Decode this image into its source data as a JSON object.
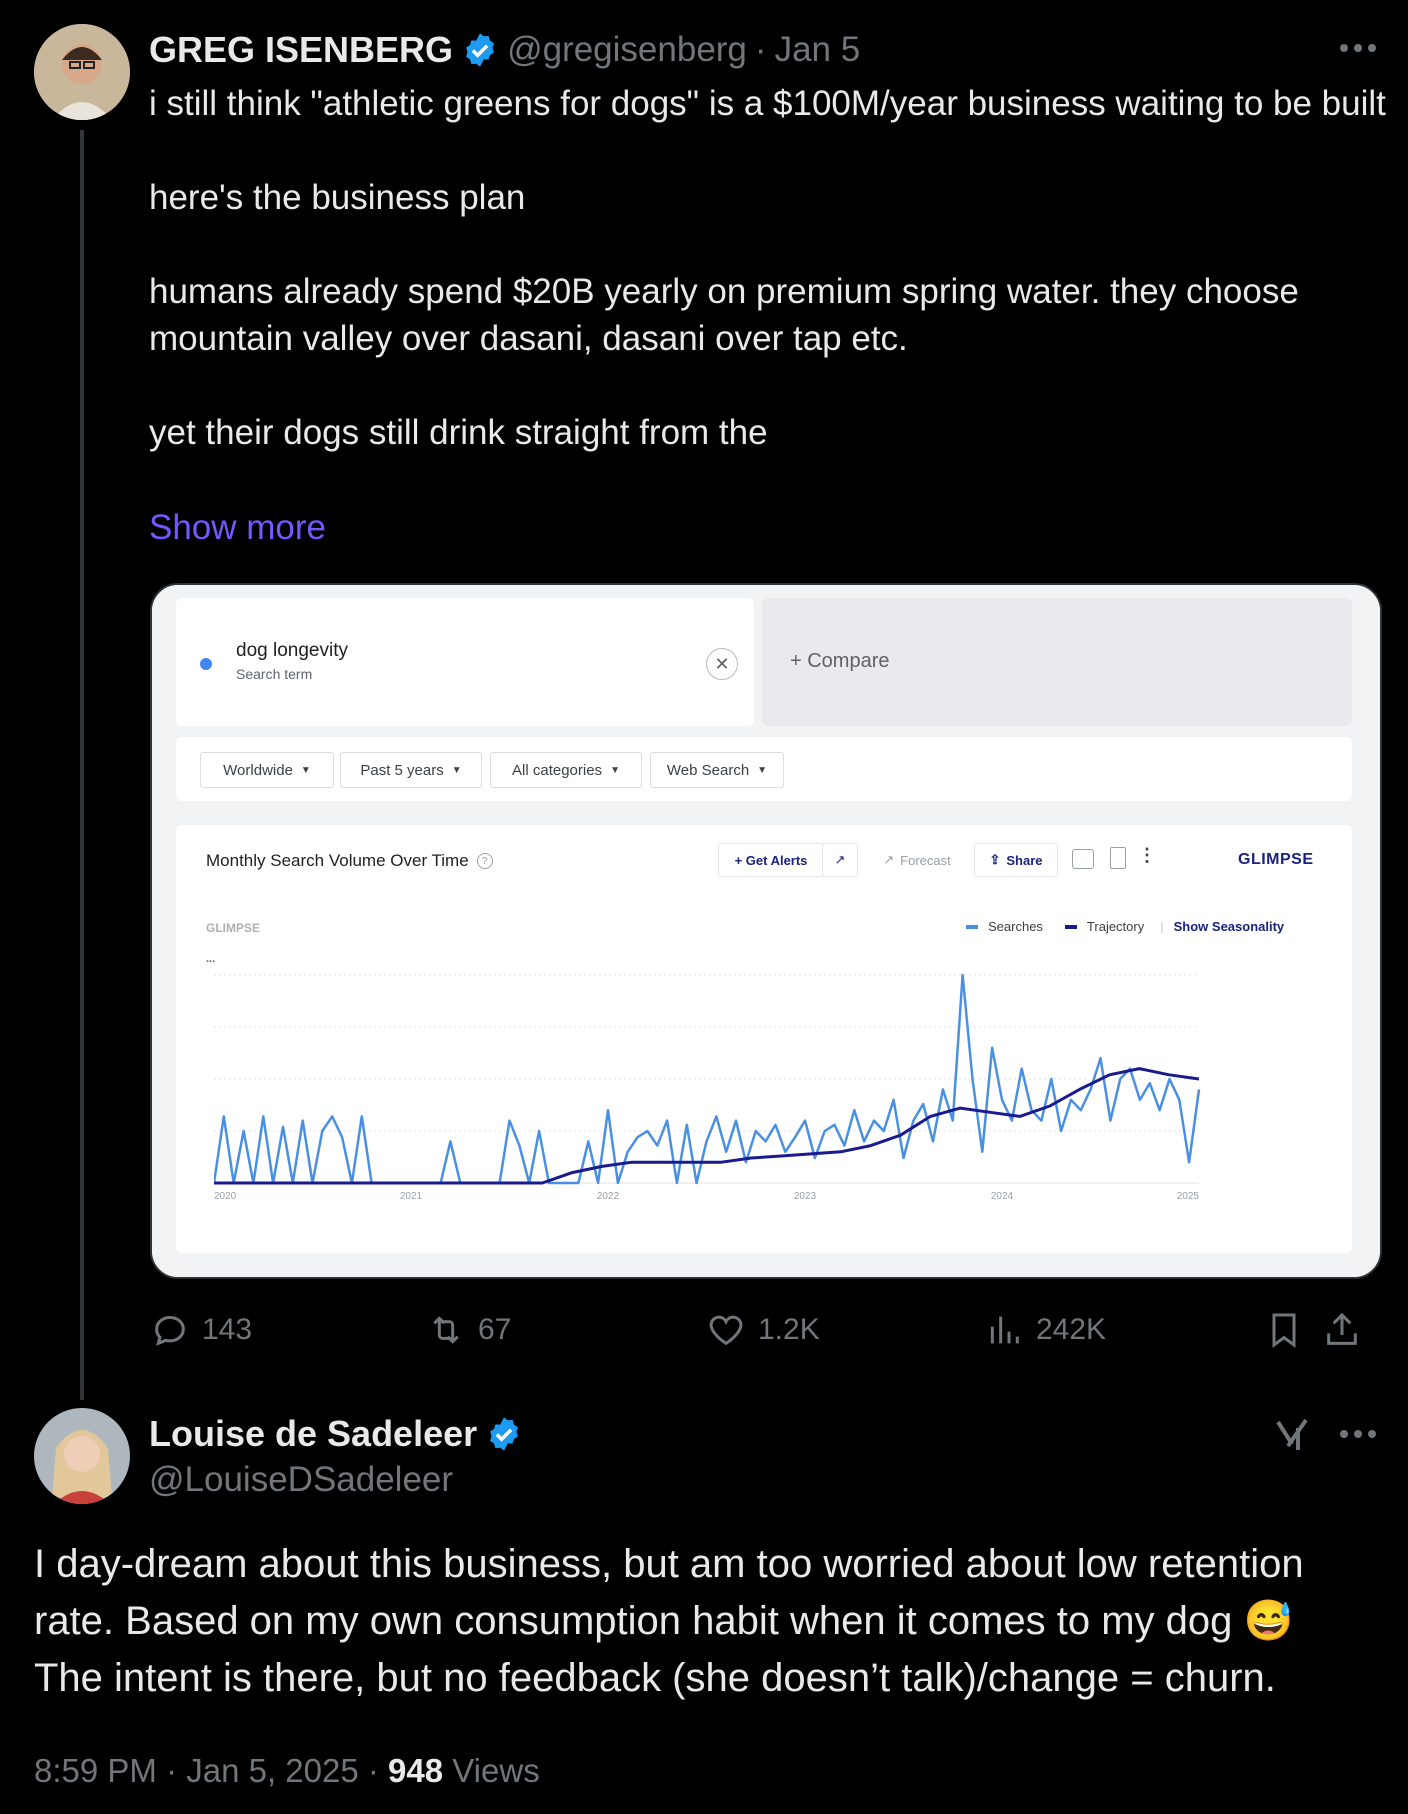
{
  "tweet": {
    "author_name": "GREG ISENBERG",
    "handle": "@gregisenberg",
    "date": "Jan 5",
    "text": "i still think \"athletic greens for dogs\" is a $100M/year business waiting to be built\n\nhere's the business plan\n\nhumans already spend $20B yearly on premium spring water. they choose mountain valley over dasani, dasani over tap etc.\n\nyet their dogs still drink straight from the",
    "show_more": "Show more",
    "more_icon": "ellipsis-icon",
    "metrics": {
      "replies": "143",
      "reposts": "67",
      "likes": "1.2K",
      "views": "242K"
    }
  },
  "embedded": {
    "search_term": "dog longevity",
    "search_term_sub": "Search term",
    "compare": "+ Compare",
    "filters": [
      "Worldwide",
      "Past 5 years",
      "All categories",
      "Web Search"
    ],
    "panel_title": "Monthly Search Volume Over Time",
    "toolbar": {
      "get_alerts": "+ Get Alerts",
      "forecast": "Forecast",
      "share": "Share",
      "brand": "GLIMPSE"
    },
    "watermark": "GLIMPSE",
    "legend": {
      "searches": "Searches",
      "trajectory": "Trajectory",
      "seasonality": "Show Seasonality"
    },
    "y_tick": "...",
    "colors": {
      "searches": "#4a90e2",
      "trajectory": "#1a1a8f"
    }
  },
  "chart_data": {
    "type": "line",
    "x": [
      "2020",
      "2021",
      "2022",
      "2023",
      "2024",
      "2025"
    ],
    "series": [
      {
        "name": "Searches",
        "values": [
          0,
          32,
          0,
          25,
          0,
          32,
          0,
          27,
          0,
          30,
          0,
          25,
          32,
          22,
          0,
          32,
          0,
          0,
          0,
          0,
          0,
          0,
          0,
          0,
          20,
          0,
          0,
          0,
          0,
          0,
          30,
          18,
          0,
          25,
          0,
          0,
          0,
          0,
          20,
          0,
          35,
          0,
          15,
          22,
          25,
          18,
          30,
          0,
          28,
          0,
          20,
          32,
          15,
          30,
          10,
          25,
          20,
          28,
          15,
          22,
          30,
          12,
          25,
          28,
          18,
          35,
          20,
          30,
          25,
          40,
          12,
          30,
          38,
          20,
          45,
          30,
          100,
          50,
          15,
          65,
          40,
          30,
          55,
          35,
          30,
          50,
          25,
          40,
          35,
          45,
          60,
          30,
          50,
          55,
          40,
          48,
          35,
          50,
          40,
          10,
          45
        ]
      },
      {
        "name": "Trajectory",
        "values": [
          0,
          0,
          0,
          0,
          0,
          0,
          0,
          0,
          0,
          0,
          0,
          0,
          5,
          8,
          10,
          10,
          10,
          10,
          12,
          13,
          14,
          15,
          18,
          23,
          32,
          36,
          34,
          32,
          37,
          45,
          52,
          55,
          52,
          50
        ]
      }
    ]
  },
  "reply": {
    "author_name": "Louise de Sadeleer",
    "handle": "@LouiseDSadeleer",
    "text_line1": "I day-dream about this business, but am too worried about low retention",
    "text_line2": "rate. Based on my own consumption habit when it comes to my dog",
    "text_line3": "The intent is there, but no feedback (she doesn’t talk)/change = churn.",
    "emoji": "😅",
    "time": "8:59 PM · Jan 5, 2025 · ",
    "views_count": "948",
    "views_label": " Views",
    "grok_icon": "grok-icon",
    "more_icon": "ellipsis-icon"
  }
}
